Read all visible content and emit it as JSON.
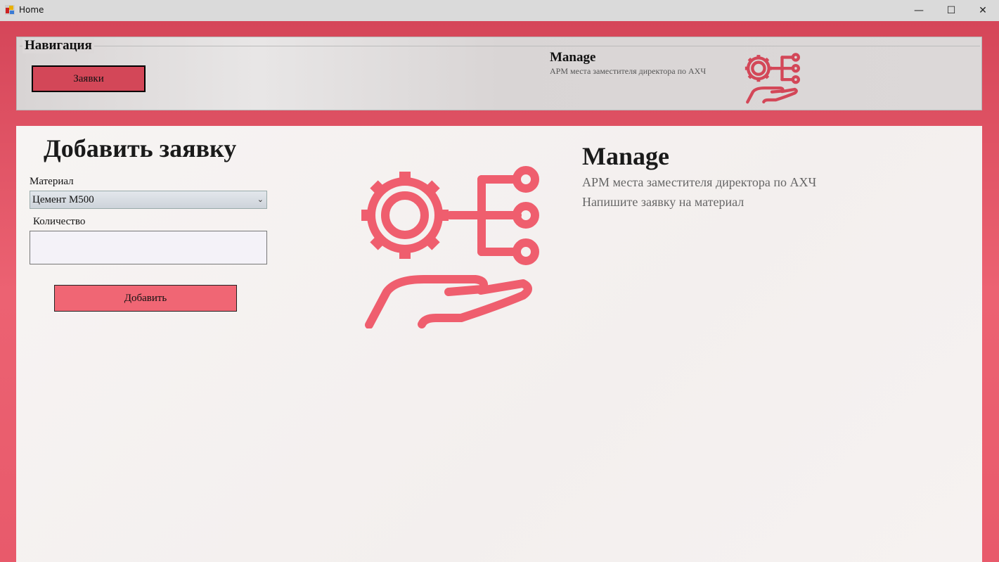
{
  "window": {
    "title": "Home",
    "minimize": "—",
    "maximize": "☐",
    "close": "✕"
  },
  "nav": {
    "legend": "Навигация",
    "requests_button": "Заявки",
    "brand_title": "Manage",
    "brand_subtitle": "АРМ места заместителя директора по АХЧ",
    "icon": "gear-network-hand-icon"
  },
  "form": {
    "heading": "Добавить заявку",
    "material_label": "Материал",
    "material_value": "Цемент М500",
    "quantity_label": "Количество",
    "quantity_value": "",
    "add_button": "Добавить"
  },
  "info": {
    "title": "Manage",
    "subtitle": "АРМ места заместителя директора по АХЧ",
    "hint": "Напишите заявку на материал"
  },
  "colors": {
    "accent": "#d34758",
    "button": "#f06674",
    "icon": "#ef5e6e"
  }
}
